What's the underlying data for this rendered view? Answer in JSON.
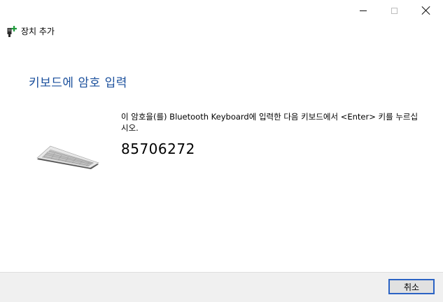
{
  "window": {
    "app_title": "장치 추가",
    "controls": {
      "minimize": "minimize-icon",
      "maximize": "maximize-icon",
      "close": "close-icon"
    }
  },
  "main": {
    "heading": "키보드에 암호 입력",
    "instruction": "이 암호을(를) Bluetooth Keyboard에 입력한 다음 키보드에서 <Enter> 키를 누르십시오.",
    "pin": "85706272",
    "illustration": "keyboard-icon"
  },
  "footer": {
    "cancel_label": "취소"
  },
  "colors": {
    "heading": "#1a4f9c",
    "button_focus_border": "#2b63c4",
    "footer_bg": "#f0f0f0"
  }
}
